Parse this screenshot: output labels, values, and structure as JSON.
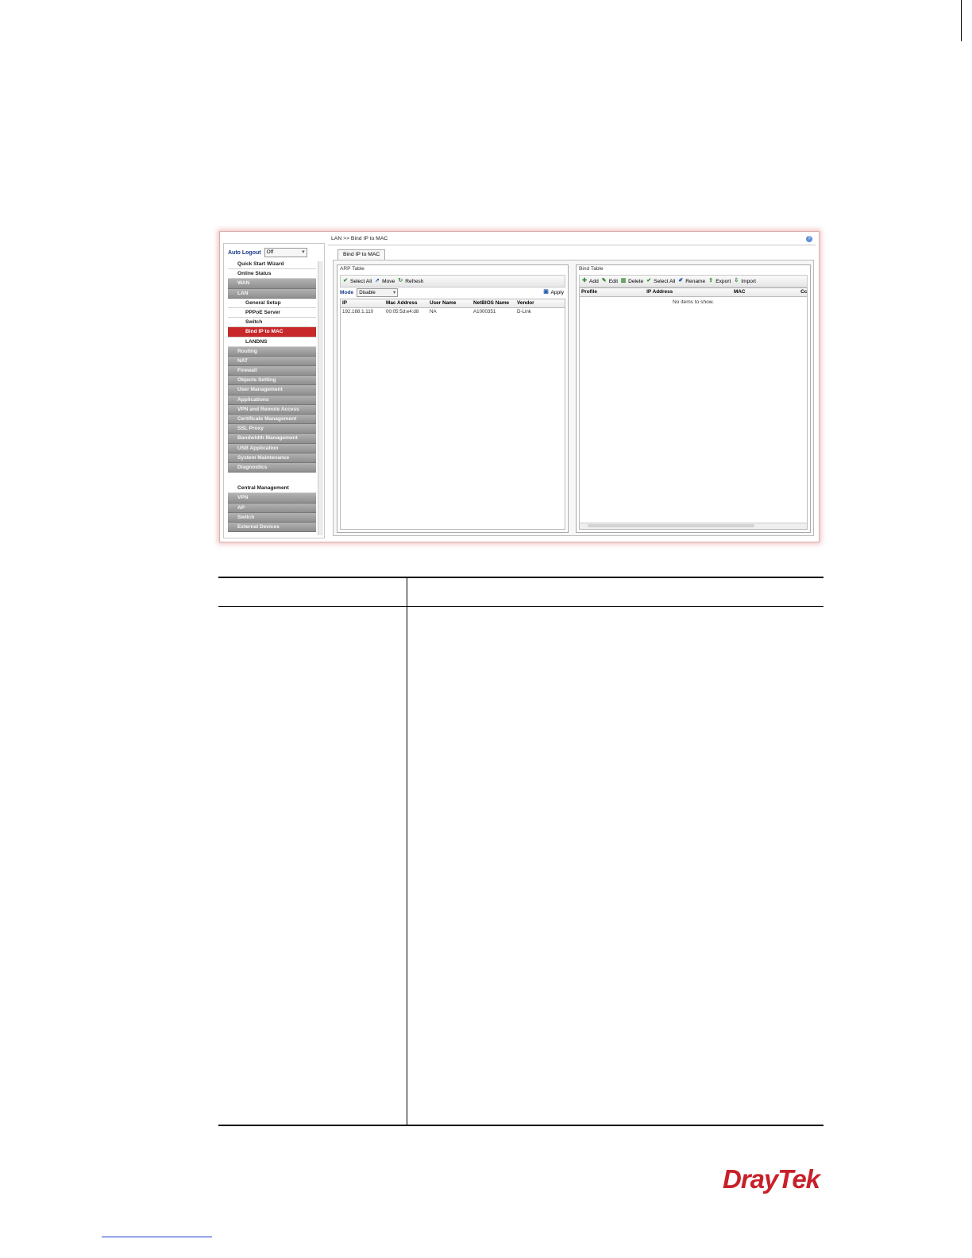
{
  "app": {
    "breadcrumb": "LAN >> Bind IP to MAC",
    "help": "?"
  },
  "sidebar": {
    "auto_logout_label": "Auto Logout",
    "auto_logout_value": "Off",
    "items": [
      {
        "label": "Quick Start Wizard",
        "style": "white"
      },
      {
        "label": "Online Status",
        "style": "white"
      },
      {
        "label": "WAN",
        "style": "gray"
      },
      {
        "label": "LAN",
        "style": "gray"
      },
      {
        "label": "General Setup",
        "style": "sub"
      },
      {
        "label": "PPPoE Server",
        "style": "sub"
      },
      {
        "label": "Switch",
        "style": "sub"
      },
      {
        "label": "Bind IP to MAC",
        "style": "active"
      },
      {
        "label": "LANDNS",
        "style": "sub"
      },
      {
        "label": "Routing",
        "style": "gray"
      },
      {
        "label": "NAT",
        "style": "gray"
      },
      {
        "label": "Firewall",
        "style": "gray"
      },
      {
        "label": "Objects Setting",
        "style": "gray"
      },
      {
        "label": "User Management",
        "style": "gray"
      },
      {
        "label": "Applications",
        "style": "gray"
      },
      {
        "label": "VPN and Remote Access",
        "style": "gray"
      },
      {
        "label": "Certificate Management",
        "style": "gray"
      },
      {
        "label": "SSL Proxy",
        "style": "gray"
      },
      {
        "label": "Bandwidth Management",
        "style": "gray"
      },
      {
        "label": "USB Application",
        "style": "gray"
      },
      {
        "label": "System Maintenance",
        "style": "gray"
      },
      {
        "label": "Diagnostics",
        "style": "gray"
      },
      {
        "label": "",
        "style": "spacer"
      },
      {
        "label": "Central Management",
        "style": "white"
      },
      {
        "label": "VPN",
        "style": "gray"
      },
      {
        "label": "AP",
        "style": "gray"
      },
      {
        "label": "Switch",
        "style": "gray"
      },
      {
        "label": "External Devices",
        "style": "gray"
      }
    ]
  },
  "tab": {
    "label": "Bind IP to MAC"
  },
  "arp_table": {
    "title": "ARP Table",
    "toolbar": {
      "select_all": "Select All",
      "move": "Move",
      "refresh": "Refresh"
    },
    "mode_label": "Mode",
    "mode_value": "Disable",
    "apply": "Apply",
    "columns": [
      "IP",
      "Mac Address",
      "User Name",
      "NetBIOS Name",
      "Vendor"
    ],
    "rows": [
      [
        "192.168.1.110",
        "00:05:5d:e4:d8",
        "NA",
        "A1000351",
        "D-Link"
      ]
    ]
  },
  "bind_table": {
    "title": "Bind Table",
    "toolbar": {
      "add": "Add",
      "edit": "Edit",
      "delete": "Delete",
      "select_all": "Select All",
      "rename": "Rename",
      "export": "Export",
      "import": "Import"
    },
    "columns": [
      "Profile",
      "IP Address",
      "MAC",
      "Cc"
    ],
    "empty_message": "No items to show."
  },
  "brand": {
    "logo_text": "DrayTek",
    "color": "#c8202a"
  }
}
